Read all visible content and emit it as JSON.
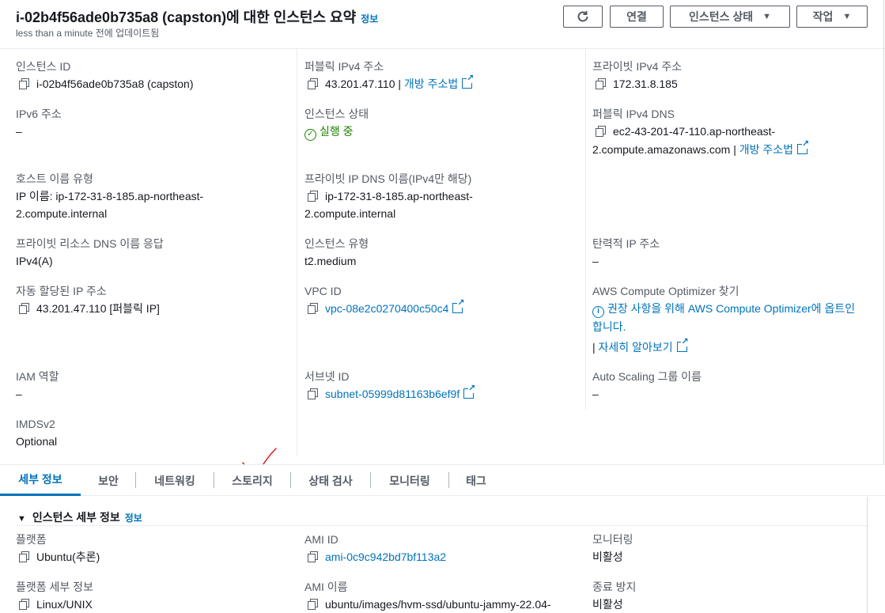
{
  "header": {
    "title": "i-02b4f56ade0b735a8 (capston)에 대한 인스턴스 요약",
    "info_label": "정보",
    "subtitle": "less than a minute 전에 업데이트됨",
    "connect_label": "연결",
    "instance_state_label": "인스턴스 상태",
    "actions_label": "작업"
  },
  "summary": {
    "instance_id": {
      "label": "인스턴스 ID",
      "value": "i-02b4f56ade0b735a8 (capston)"
    },
    "public_ipv4": {
      "label": "퍼블릭 IPv4 주소",
      "value": "43.201.47.110 |",
      "link": "개방 주소법"
    },
    "private_ipv4": {
      "label": "프라이빗 IPv4 주소",
      "value": "172.31.8.185"
    },
    "ipv6": {
      "label": "IPv6 주소",
      "value": "–"
    },
    "instance_state": {
      "label": "인스턴스 상태",
      "value": "실행 중"
    },
    "public_dns": {
      "label": "퍼블릭 IPv4 DNS",
      "line1": "ec2-43-201-47-110.ap-northeast-",
      "line2": "2.compute.amazonaws.com |",
      "link": "개방 주소법"
    },
    "hostname_type": {
      "label": "호스트 이름 유형",
      "line1": "IP 이름: ip-172-31-8-185.ap-northeast-",
      "line2": "2.compute.internal"
    },
    "private_dns": {
      "label": "프라이빗 IP DNS 이름(IPv4만 해당)",
      "line1": "ip-172-31-8-185.ap-northeast-",
      "line2": "2.compute.internal"
    },
    "private_resource_dns": {
      "label": "프라이빗 리소스 DNS 이름 응답",
      "value": "IPv4(A)"
    },
    "instance_type": {
      "label": "인스턴스 유형",
      "value": "t2.medium"
    },
    "elastic_ip": {
      "label": "탄력적 IP 주소",
      "value": "–"
    },
    "auto_ip": {
      "label": "자동 할당된 IP 주소",
      "value": "43.201.47.110 [퍼블릭 IP]"
    },
    "vpc_id": {
      "label": "VPC ID",
      "value": "vpc-08e2c0270400c50c4"
    },
    "optimizer": {
      "label": "AWS Compute Optimizer 찾기",
      "line1": "권장 사항을 위해 AWS Compute Optimizer에 옵트인",
      "line2": "합니다.",
      "learn_more": "자세히 알아보기"
    },
    "iam_role": {
      "label": "IAM 역할",
      "value": "–"
    },
    "subnet_id": {
      "label": "서브넷 ID",
      "value": "subnet-05999d81163b6ef9f"
    },
    "asg_name": {
      "label": "Auto Scaling 그룹 이름",
      "value": "–"
    },
    "imdsv2": {
      "label": "IMDSv2",
      "value": "Optional"
    }
  },
  "tabs": [
    "세부 정보",
    "보안",
    "네트워킹",
    "스토리지",
    "상태 검사",
    "모니터링",
    "태그"
  ],
  "details": {
    "section_title": "인스턴스 세부 정보",
    "info_label": "정보",
    "platform": {
      "label": "플랫폼",
      "value": "Ubuntu(추론)"
    },
    "ami_id": {
      "label": "AMI ID",
      "value": "ami-0c9c942bd7bf113a2"
    },
    "monitoring": {
      "label": "모니터링",
      "value": "비활성"
    },
    "platform_details": {
      "label": "플랫폼 세부 정보",
      "value": "Linux/UNIX"
    },
    "ami_name": {
      "label": "AMI 이름",
      "value": "ubuntu/images/hvm-ssd/ubuntu-jammy-22.04-"
    },
    "termination_protection": {
      "label": "종료 방지",
      "value": "비활성"
    }
  },
  "colors": {
    "link": "#0073bb",
    "running": "#1d8102",
    "annotation": "#e0161b"
  }
}
